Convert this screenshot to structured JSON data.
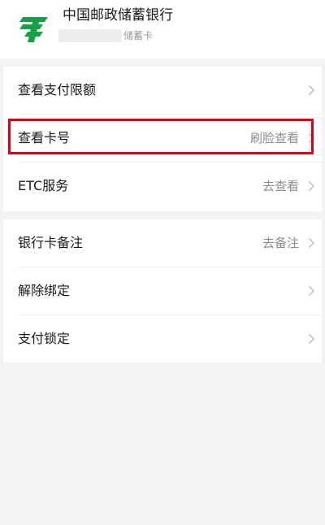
{
  "header": {
    "bank_name": "中国邮政储蓄银行",
    "card_type": "储蓄卡",
    "logo_icon": "postal-savings-bank-logo-icon",
    "brand_color": "#18a049"
  },
  "menu_group_1": [
    {
      "label": "查看支付限额",
      "value": ""
    },
    {
      "label": "查看卡号",
      "value": "刷脸查看"
    },
    {
      "label": "ETC服务",
      "value": "去查看"
    }
  ],
  "menu_group_2": [
    {
      "label": "银行卡备注",
      "value": "去备注"
    },
    {
      "label": "解除绑定",
      "value": ""
    },
    {
      "label": "支付锁定",
      "value": ""
    }
  ],
  "highlight_color": "#e00012",
  "chevron_icon": "chevron-right-icon"
}
